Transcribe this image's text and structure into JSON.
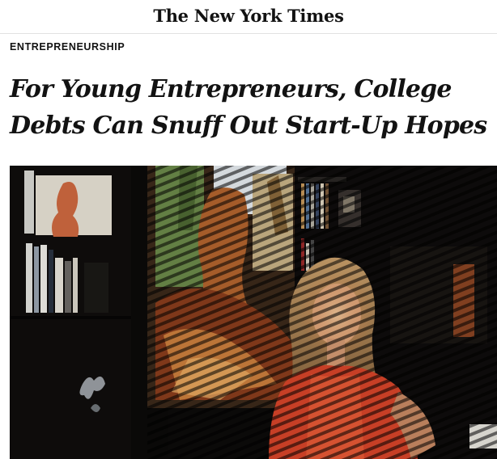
{
  "masthead": {
    "logo_text": "The New York Times"
  },
  "article": {
    "kicker": "ENTREPRENEURSHIP",
    "headline": "For Young Entrepreneurs, College Debts Can Snuff Out Start-Up Hopes"
  },
  "colors": {
    "text": "#121212",
    "rule": "#e2e2e2",
    "photo_dark": "#0b0a09",
    "photo_warm": "#c8773e",
    "shirt_red": "#d8452a"
  },
  "icons": [
    "nyt-logo-icon"
  ]
}
